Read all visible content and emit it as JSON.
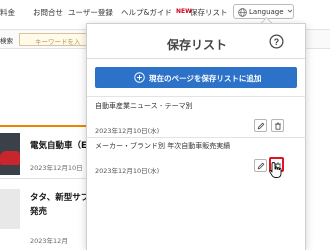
{
  "nav": {
    "items": [
      "料金",
      "お問合せ",
      "ユーザー登録",
      "ヘルプ&ガイド"
    ],
    "new_badge": "NEW",
    "saved_list": "保存リスト",
    "language": "Language"
  },
  "search": {
    "category": "検索",
    "placeholder": "キーワードを入"
  },
  "background_articles": [
    {
      "title": "電気自動車（EV",
      "date": "2023年12月10日"
    },
    {
      "title_line1": "タタ、新型サブ",
      "title_line2": "発売",
      "date": "2023年12月"
    }
  ],
  "popup": {
    "title": "保存リスト",
    "add_button": "現在のページを保存リストに追加",
    "items": [
      {
        "label": "自動車産業ニュース - テーマ別",
        "date": "2023年12月10日(水)"
      },
      {
        "label": "メーカー・ブランド別 年次自動車販売実績",
        "date": "2023年12月10日(水)"
      }
    ]
  },
  "colors": {
    "accent_blue": "#2d72c9",
    "highlight_red": "#e0141d",
    "new_red": "#d0021b",
    "orange": "#f08300"
  },
  "icons": [
    "globe-icon",
    "chevron-down-icon",
    "help-icon",
    "plus-circle-icon",
    "pencil-icon",
    "trash-icon",
    "hand-cursor-icon"
  ]
}
